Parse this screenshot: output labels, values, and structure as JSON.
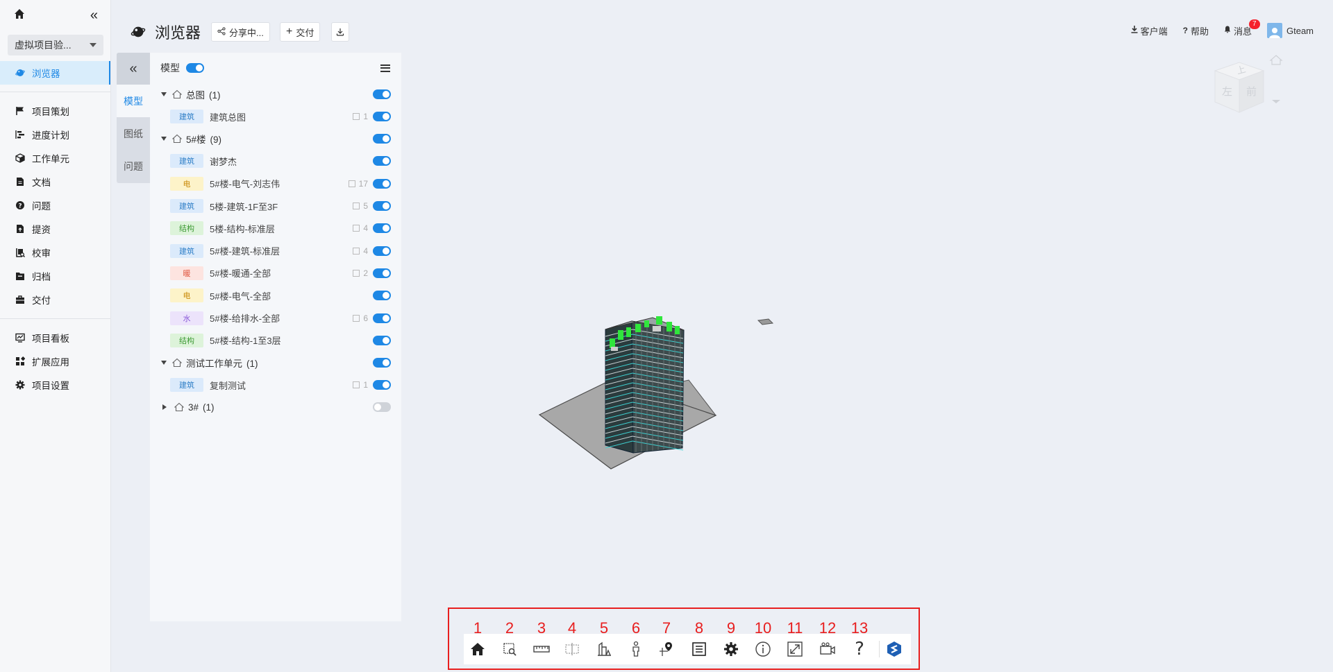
{
  "sidebar": {
    "project_name": "虚拟项目验...",
    "items": [
      {
        "label": "浏览器",
        "icon": "globe-icon",
        "active": true
      },
      {
        "label": "项目策划",
        "icon": "flag-icon"
      },
      {
        "label": "进度计划",
        "icon": "gantt-icon"
      },
      {
        "label": "工作单元",
        "icon": "cube-icon"
      },
      {
        "label": "文档",
        "icon": "document-icon"
      },
      {
        "label": "问题",
        "icon": "question-icon"
      },
      {
        "label": "提资",
        "icon": "upload-doc-icon"
      },
      {
        "label": "校审",
        "icon": "review-icon"
      },
      {
        "label": "归档",
        "icon": "archive-icon"
      },
      {
        "label": "交付",
        "icon": "briefcase-icon"
      },
      {
        "label": "项目看板",
        "icon": "dashboard-icon"
      },
      {
        "label": "扩展应用",
        "icon": "apps-icon"
      },
      {
        "label": "项目设置",
        "icon": "gear-icon"
      }
    ]
  },
  "header": {
    "title": "浏览器",
    "share_label": "分享中...",
    "deliver_label": "交付",
    "client_label": "客户端",
    "help_label": "帮助",
    "messages_label": "消息",
    "messages_count": "7",
    "user_name": "Gteam"
  },
  "side_tabs": [
    "模型",
    "图纸",
    "问题"
  ],
  "model_panel": {
    "title": "模型",
    "groups": [
      {
        "name": "总图",
        "count": "(1)",
        "expanded": true,
        "on": true,
        "items": [
          {
            "tag": "建筑",
            "tag_color": "#dbeafb",
            "tag_text_color": "#2f7fc7",
            "name": "建筑总图",
            "count": "1",
            "on": true
          }
        ]
      },
      {
        "name": "5#楼",
        "count": "(9)",
        "expanded": true,
        "on": true,
        "items": [
          {
            "tag": "建筑",
            "tag_color": "#dbeafb",
            "tag_text_color": "#2f7fc7",
            "name": "谢梦杰",
            "count": "",
            "on": true
          },
          {
            "tag": "电",
            "tag_color": "#fdf3c9",
            "tag_text_color": "#c98a0a",
            "name": "5#楼-电气-刘志伟",
            "count": "17",
            "on": true
          },
          {
            "tag": "建筑",
            "tag_color": "#dbeafb",
            "tag_text_color": "#2f7fc7",
            "name": "5楼-建筑-1F至3F",
            "count": "5",
            "on": true
          },
          {
            "tag": "结构",
            "tag_color": "#ddf3da",
            "tag_text_color": "#3d9a34",
            "name": "5楼-结构-标准层",
            "count": "4",
            "on": true
          },
          {
            "tag": "建筑",
            "tag_color": "#dbeafb",
            "tag_text_color": "#2f7fc7",
            "name": "5#楼-建筑-标准层",
            "count": "4",
            "on": true
          },
          {
            "tag": "暖",
            "tag_color": "#fde4e0",
            "tag_text_color": "#e0553f",
            "name": "5#楼-暖通-全部",
            "count": "2",
            "on": true
          },
          {
            "tag": "电",
            "tag_color": "#fdf3c9",
            "tag_text_color": "#c98a0a",
            "name": "5#楼-电气-全部",
            "count": "",
            "on": true
          },
          {
            "tag": "水",
            "tag_color": "#ece3fb",
            "tag_text_color": "#8a5ad8",
            "name": "5#楼-给排水-全部",
            "count": "6",
            "on": true
          },
          {
            "tag": "结构",
            "tag_color": "#ddf3da",
            "tag_text_color": "#3d9a34",
            "name": "5#楼-结构-1至3层",
            "count": "",
            "on": true
          }
        ]
      },
      {
        "name": "测试工作单元",
        "count": "(1)",
        "expanded": true,
        "on": true,
        "items": [
          {
            "tag": "建筑",
            "tag_color": "#dbeafb",
            "tag_text_color": "#2f7fc7",
            "name": "复制测试",
            "count": "1",
            "on": true
          }
        ]
      },
      {
        "name": "3#",
        "count": "(1)",
        "expanded": false,
        "on": false,
        "items": []
      }
    ]
  },
  "view_cube": {
    "top": "上",
    "left": "左",
    "front": "前"
  },
  "toolbar": {
    "numbers": [
      "1",
      "2",
      "3",
      "4",
      "5",
      "6",
      "7",
      "8",
      "9",
      "10",
      "11",
      "12",
      "13"
    ],
    "buttons": [
      "home-view",
      "zoom-box",
      "measure",
      "section",
      "elevation",
      "person-walk",
      "location-pin",
      "properties-list",
      "settings",
      "info",
      "fullscreen",
      "camera",
      "help",
      "logo"
    ],
    "highlight_color": "#e81e1e"
  }
}
